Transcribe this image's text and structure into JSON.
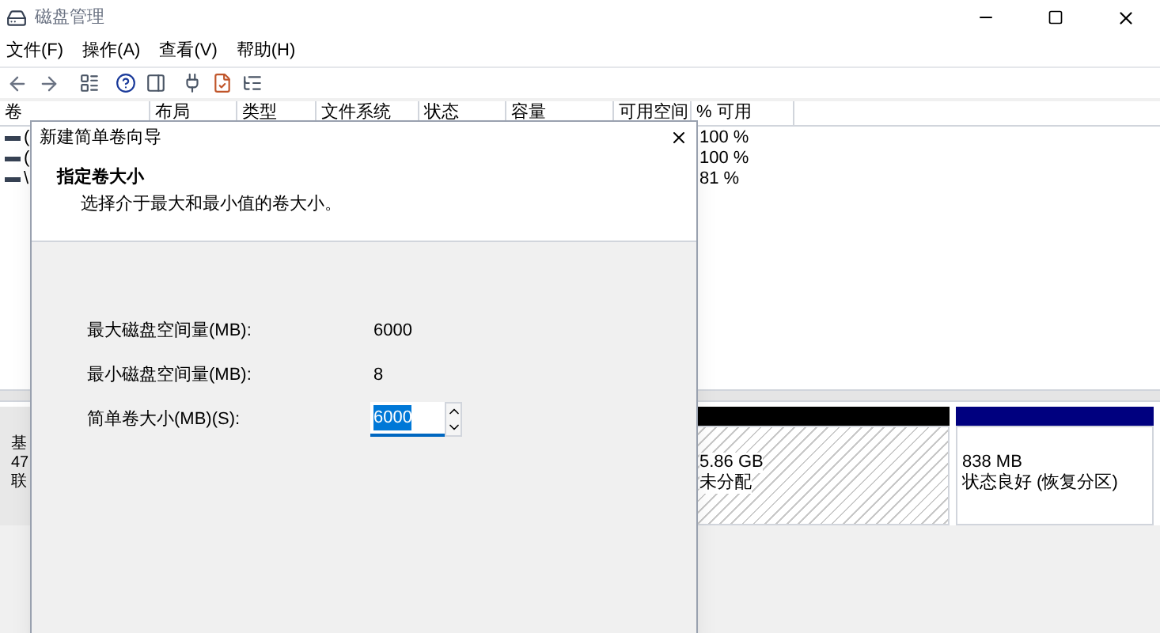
{
  "window": {
    "title": "磁盘管理"
  },
  "menu": [
    {
      "label": "文件(F)"
    },
    {
      "label": "操作(A)"
    },
    {
      "label": "查看(V)"
    },
    {
      "label": "帮助(H)"
    }
  ],
  "table": {
    "columns": [
      "卷",
      "布局",
      "类型",
      "文件系统",
      "状态",
      "容量",
      "可用空间",
      "% 可用"
    ],
    "rows": [
      {
        "volume": "(",
        "percent_free": "100 %"
      },
      {
        "volume": "(",
        "percent_free": "100 %"
      },
      {
        "volume": "\\",
        "percent_free": "81 %"
      }
    ]
  },
  "disk_map": {
    "disk_label": [
      "基",
      "47",
      "联"
    ],
    "partitions": [
      {
        "kind": "unallocated",
        "color": "#000000",
        "size": "5.86 GB",
        "status": "未分配"
      },
      {
        "kind": "primary",
        "color": "#00007f",
        "size": "838 MB",
        "status": "状态良好 (恢复分区)"
      }
    ]
  },
  "dialog": {
    "title": "新建简单卷向导",
    "heading": "指定卷大小",
    "subtitle": "选择介于最大和最小值的卷大小。",
    "fields": [
      {
        "kind": "value",
        "label": "最大磁盘空间量(MB):",
        "value": "6000"
      },
      {
        "kind": "value",
        "label": "最小磁盘空间量(MB):",
        "value": "8"
      },
      {
        "kind": "spinner",
        "label": "简单卷大小(MB)(S):",
        "value": "6000",
        "text_selected": true
      }
    ]
  }
}
